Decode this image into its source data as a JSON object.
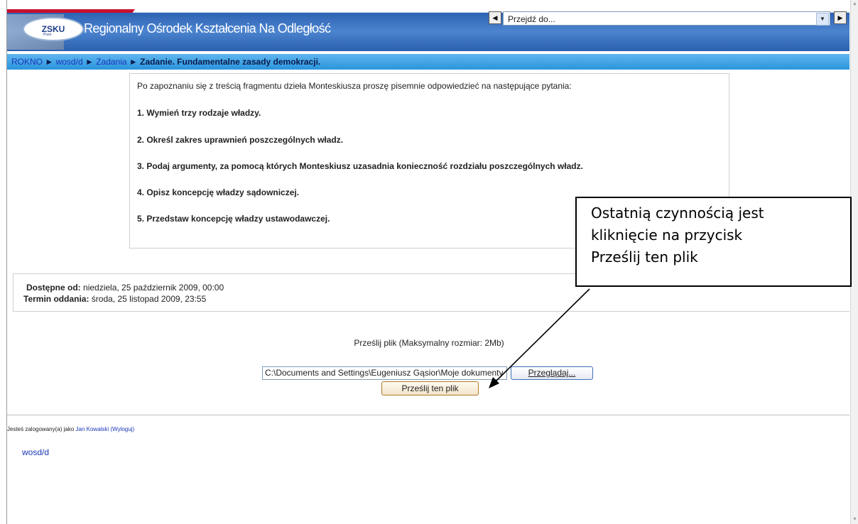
{
  "header": {
    "logo_text": "ZSKU",
    "logo_sub": "Pozn.",
    "site_title": "Regionalny Ośrodek Kształcenia Na Odległość",
    "jump_select": "Przejdź do...",
    "icons": {
      "prev": "triangle-left-icon",
      "next": "triangle-right-icon",
      "dropdown": "chevron-down-icon"
    }
  },
  "breadcrumb": {
    "items": [
      "ROKNO",
      "wosd/d",
      "Zadania"
    ],
    "separator": "►",
    "current": "Zadanie. Fundamentalne zasady demokracji."
  },
  "intro": {
    "lead": "Po zapoznaniu się z treścią fragmentu dzieła Monteskiusza proszę pisemnie odpowiedzieć na następujące pytania:",
    "questions": [
      "1. Wymień trzy rodzaje władzy.",
      "2. Określ zakres uprawnień poszczególnych władz.",
      "3. Podaj argumenty, za pomocą których Monteskiusz uzasadnia konieczność rozdziału poszczególnych władz.",
      "4. Opisz koncepcję władzy sądowniczej.",
      "5. Przedstaw koncepcję władzy ustawodawczej."
    ]
  },
  "dates": {
    "available_label": "Dostępne od:",
    "available_value": "niedziela, 25 październik 2009, 00:00",
    "due_label": "Termin oddania:",
    "due_value": "środa, 25 listopad 2009, 23:55"
  },
  "upload": {
    "title": "Prześlij plik (Maksymalny rozmiar: 2Mb)",
    "file_path": "C:\\Documents and Settings\\Eugeniusz Gąsior\\Moje dokumenty",
    "browse_label": "Przeglądaj...",
    "submit_label": "Prześlij ten plik"
  },
  "footer": {
    "logged_prefix": "Jesteś zalogowany(a) jako",
    "user_name": "Jan Kowalski",
    "logout": "(Wyloguj)",
    "course_link": "wosd/d"
  },
  "callout": {
    "lines": [
      "Ostatnią czynnością jest",
      "kliknięcie na przycisk",
      "Prześlij ten plik"
    ]
  },
  "colors": {
    "header_blue": "#3a72c2",
    "navbar_blue": "#3fa3e6",
    "link": "#1a36b8"
  }
}
